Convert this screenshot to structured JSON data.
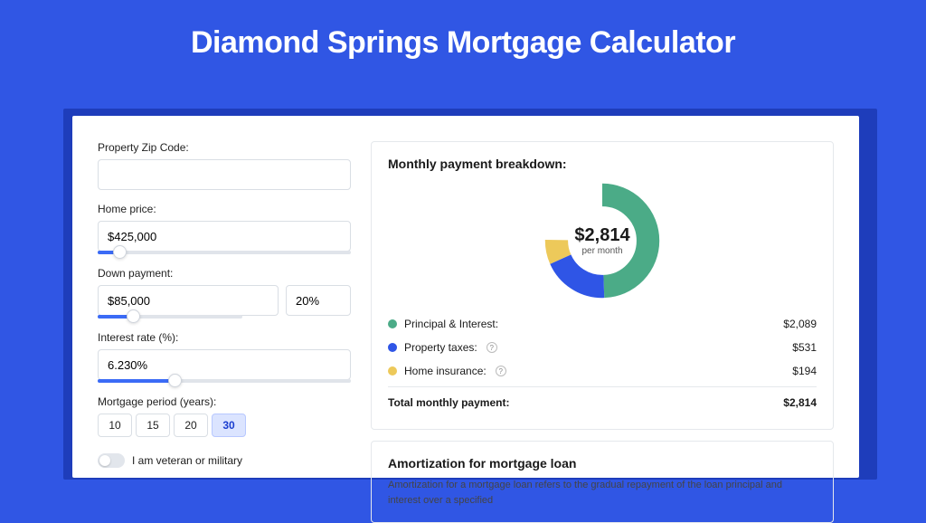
{
  "title": "Diamond Springs Mortgage Calculator",
  "left": {
    "zip_label": "Property Zip Code:",
    "zip_value": "",
    "price_label": "Home price:",
    "price_value": "$425,000",
    "down_label": "Down payment:",
    "down_value": "$85,000",
    "down_pct": "20%",
    "rate_label": "Interest rate (%):",
    "rate_value": "6.230%",
    "period_label": "Mortgage period (years):",
    "periods": [
      "10",
      "15",
      "20",
      "30"
    ],
    "period_active": "30",
    "vet_label": "I am veteran or military"
  },
  "breakdown": {
    "heading": "Monthly payment breakdown:",
    "center_big": "$2,814",
    "center_small": "per month",
    "rows": [
      {
        "label": "Principal & Interest:",
        "value": "$2,089",
        "color": "#4bab87",
        "info": false
      },
      {
        "label": "Property taxes:",
        "value": "$531",
        "color": "#2f55e6",
        "info": true
      },
      {
        "label": "Home insurance:",
        "value": "$194",
        "color": "#edc95a",
        "info": true
      }
    ],
    "total_label": "Total monthly payment:",
    "total_value": "$2,814"
  },
  "amort": {
    "heading": "Amortization for mortgage loan",
    "body": "Amortization for a mortgage loan refers to the gradual repayment of the loan principal and interest over a specified"
  },
  "chart_data": {
    "type": "pie",
    "title": "Monthly payment breakdown",
    "series": [
      {
        "name": "Principal & Interest",
        "value": 2089,
        "color": "#4bab87"
      },
      {
        "name": "Property taxes",
        "value": 531,
        "color": "#2f55e6"
      },
      {
        "name": "Home insurance",
        "value": 194,
        "color": "#edc95a"
      }
    ],
    "total": 2814,
    "center_label": "$2,814 per month"
  }
}
